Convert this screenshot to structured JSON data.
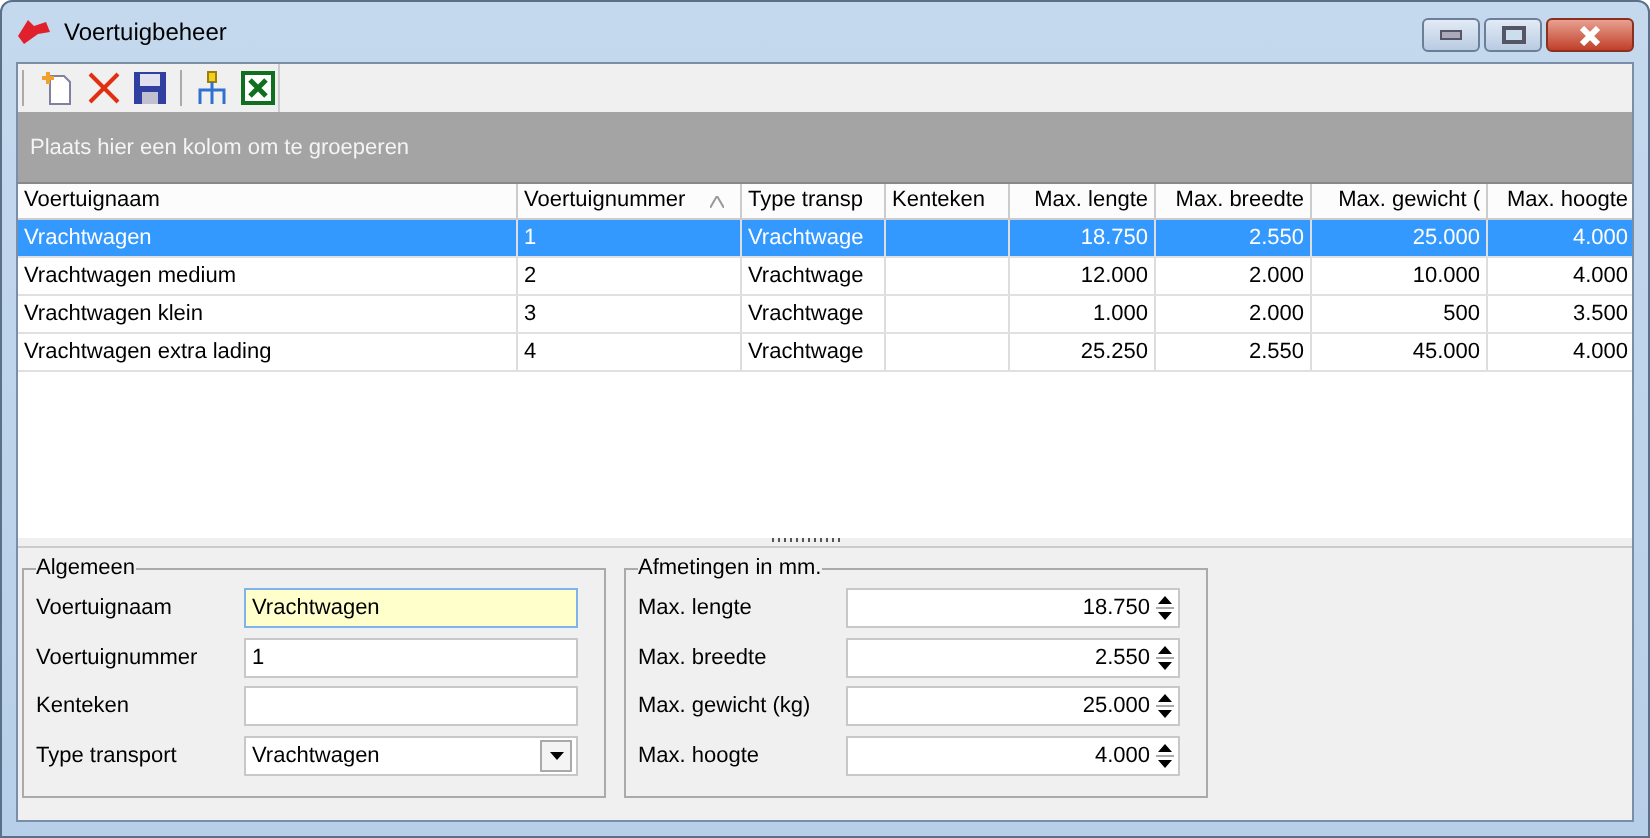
{
  "window": {
    "title": "Voertuigbeheer"
  },
  "toolbar": [
    {
      "kind": "new"
    },
    {
      "kind": "delete"
    },
    {
      "kind": "save"
    },
    {
      "kind": "separator"
    },
    {
      "kind": "hierarchy"
    },
    {
      "kind": "excel"
    }
  ],
  "group_panel": {
    "text": "Plaats hier een kolom om te groeperen"
  },
  "table": {
    "columns": [
      {
        "label": "Voertuignaam",
        "sorted": false,
        "numeric": false
      },
      {
        "label": "Voertuignummer",
        "sorted": true,
        "numeric": false
      },
      {
        "label": "Type transp",
        "sorted": false,
        "numeric": false
      },
      {
        "label": "Kenteken",
        "sorted": false,
        "numeric": false
      },
      {
        "label": "Max. lengte",
        "sorted": false,
        "numeric": true
      },
      {
        "label": "Max. breedte",
        "sorted": false,
        "numeric": true
      },
      {
        "label": "Max. gewicht (",
        "sorted": false,
        "numeric": true
      },
      {
        "label": "Max. hoogte",
        "sorted": false,
        "numeric": true
      }
    ],
    "rows": [
      {
        "selected": true,
        "cells": [
          "Vrachtwagen",
          "1",
          "Vrachtwage",
          "",
          "18.750",
          "2.550",
          "25.000",
          "4.000"
        ]
      },
      {
        "selected": false,
        "cells": [
          "Vrachtwagen medium",
          "2",
          "Vrachtwage",
          "",
          "12.000",
          "2.000",
          "10.000",
          "4.000"
        ]
      },
      {
        "selected": false,
        "cells": [
          "Vrachtwagen klein",
          "3",
          "Vrachtwage",
          "",
          "1.000",
          "2.000",
          "500",
          "3.500"
        ]
      },
      {
        "selected": false,
        "cells": [
          "Vrachtwagen extra lading",
          "4",
          "Vrachtwage",
          "",
          "25.250",
          "2.550",
          "45.000",
          "4.000"
        ]
      }
    ]
  },
  "general": {
    "title": "Algemeen",
    "fields": [
      {
        "label": "Voertuignaam",
        "kind": "text",
        "value": "Vrachtwagen",
        "focused": true
      },
      {
        "label": "Voertuignummer",
        "kind": "text",
        "value": "1",
        "focused": false
      },
      {
        "label": "Kenteken",
        "kind": "text",
        "focused": false
      },
      {
        "label": "Type transport",
        "kind": "dropdown",
        "value": "Vrachtwagen"
      }
    ]
  },
  "dimensions": {
    "title": "Afmetingen in mm.",
    "fields": [
      {
        "label": "Max. lengte",
        "value": "18.750"
      },
      {
        "label": "Max. breedte",
        "value": "2.550"
      },
      {
        "label": "Max. gewicht (kg)",
        "value": "25.000"
      },
      {
        "label": "Max. hoogte",
        "value": "4.000"
      }
    ]
  }
}
